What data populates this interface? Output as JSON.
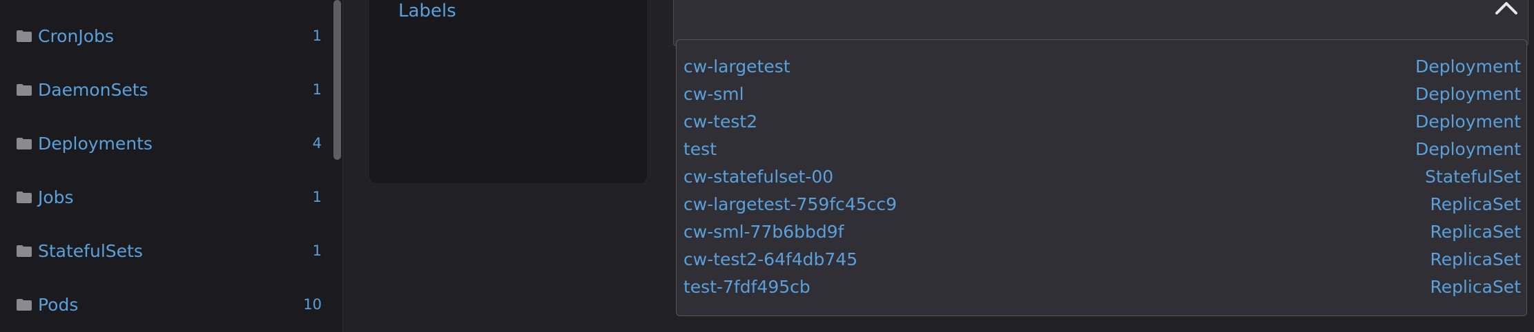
{
  "sidebar": {
    "items": [
      {
        "label": "CronJobs",
        "count": "1",
        "icon": "folder-icon"
      },
      {
        "label": "DaemonSets",
        "count": "1",
        "icon": "folder-icon"
      },
      {
        "label": "Deployments",
        "count": "4",
        "icon": "folder-icon"
      },
      {
        "label": "Jobs",
        "count": "1",
        "icon": "folder-icon"
      },
      {
        "label": "StatefulSets",
        "count": "1",
        "icon": "folder-icon"
      },
      {
        "label": "Pods",
        "count": "10",
        "icon": "folder-icon"
      }
    ]
  },
  "panel": {
    "labels_link": "Labels"
  },
  "search": {
    "close_icon": "close-icon",
    "results": [
      {
        "name": "cw-largetest",
        "kind": "Deployment"
      },
      {
        "name": "cw-sml",
        "kind": "Deployment"
      },
      {
        "name": "cw-test2",
        "kind": "Deployment"
      },
      {
        "name": "test",
        "kind": "Deployment"
      },
      {
        "name": "cw-statefulset-00",
        "kind": "StatefulSet"
      },
      {
        "name": "cw-largetest-759fc45cc9",
        "kind": "ReplicaSet"
      },
      {
        "name": "cw-sml-77b6bbd9f",
        "kind": "ReplicaSet"
      },
      {
        "name": "cw-test2-64f4db745",
        "kind": "ReplicaSet"
      },
      {
        "name": "test-7fdf495cb",
        "kind": "ReplicaSet"
      }
    ]
  },
  "colors": {
    "link": "#5aa0db",
    "sidebar_bg": "#1b1b1f",
    "page_bg": "#222226",
    "dropdown_bg": "#2f2f35"
  }
}
